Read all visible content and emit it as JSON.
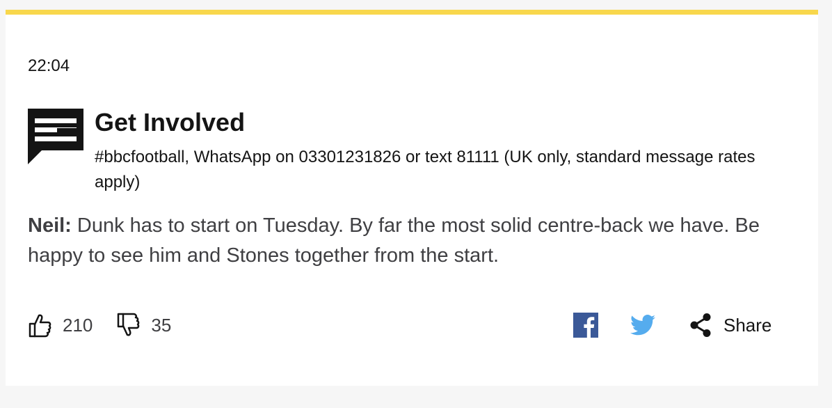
{
  "post": {
    "time": "22:04"
  },
  "get_involved": {
    "title": "Get Involved",
    "subtitle": "#bbcfootball, WhatsApp on 03301231826 or text 81111 (UK only, standard message rates apply)"
  },
  "comment": {
    "author": "Neil:",
    "text": " Dunk has to start on Tuesday. By far the most solid centre-back we have. Be happy to see him and Stones together from the start."
  },
  "reactions": {
    "likes": "210",
    "dislikes": "35"
  },
  "share": {
    "label": "Share",
    "facebook_icon": "facebook-icon",
    "twitter_icon": "twitter-icon",
    "share_icon": "share-icon"
  },
  "colors": {
    "accent_bar": "#f8d74c",
    "facebook": "#3b5998",
    "twitter": "#55acee"
  }
}
